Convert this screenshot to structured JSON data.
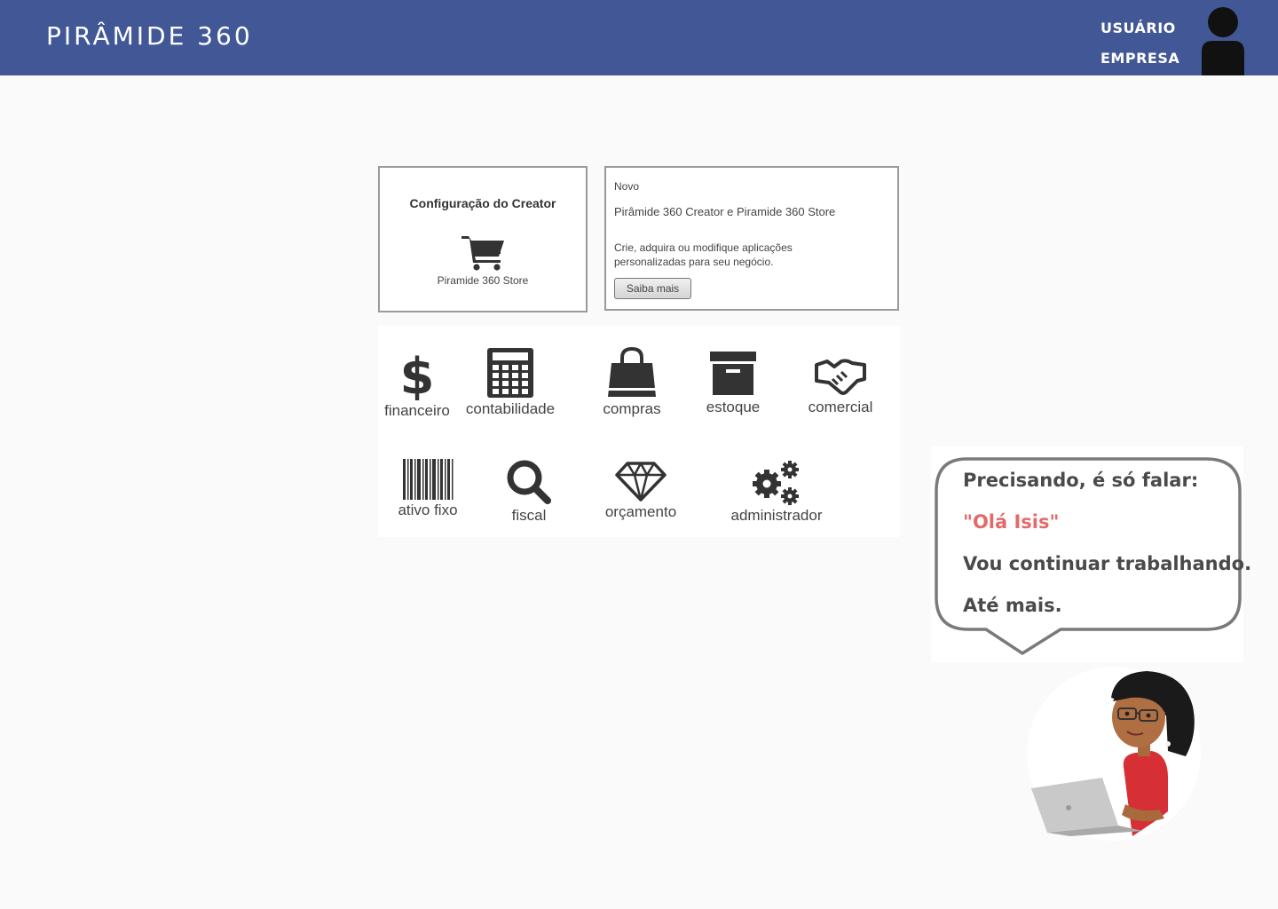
{
  "header": {
    "brand": "PIRÂMIDE 360",
    "user_label": "USUÁRIO",
    "company_label": "EMPRESA"
  },
  "config_card": {
    "title": "Configuração do Creator",
    "store_label": "Piramide 360 Store"
  },
  "news_card": {
    "badge": "Novo",
    "headline": "Pirâmide 360 Creator e Piramide 360 Store",
    "description": "Crie, adquira ou modifique aplicações personalizadas para seu negócio.",
    "button_label": "Saiba mais"
  },
  "modules": {
    "financeiro": "financeiro",
    "contabilidade": "contabilidade",
    "compras": "compras",
    "estoque": "estoque",
    "comercial": "comercial",
    "ativo_fixo": "ativo fixo",
    "fiscal": "fiscal",
    "orcamento": "orçamento",
    "administrador": "administrador"
  },
  "assistant": {
    "line1": "Precisando, é só falar:",
    "line2": "\"Olá Isis\"",
    "line3": "Vou continuar trabalhando.",
    "line4": "Até mais."
  },
  "colors": {
    "header_bg": "#425896",
    "highlight": "#e46a6a",
    "icon": "#333333"
  }
}
